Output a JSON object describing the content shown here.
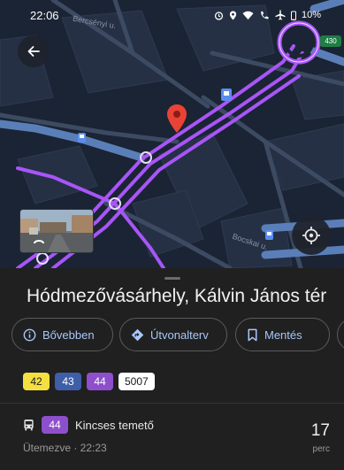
{
  "status_bar": {
    "time": "22:06",
    "battery": "10%",
    "icons": [
      "alarm-icon",
      "location-icon",
      "wifi-icon",
      "wifi-calling-icon",
      "airplane-icon",
      "battery-icon"
    ]
  },
  "map": {
    "streets": [
      "Bercsényi u.",
      "Bocskai u."
    ],
    "road_number": "430",
    "route_color": "#a855f7",
    "pin_color": "#ea4335"
  },
  "place": {
    "title": "Hódmezővásárhely, Kálvin János tér"
  },
  "actions": [
    {
      "label": "Bővebben",
      "icon": "info-icon"
    },
    {
      "label": "Útvonalterv",
      "icon": "directions-icon"
    },
    {
      "label": "Mentés",
      "icon": "bookmark-icon"
    },
    {
      "label": "",
      "icon": "share-icon"
    }
  ],
  "routes": [
    {
      "number": "42",
      "bg": "#f5e042",
      "fg": "#1a1a1a"
    },
    {
      "number": "43",
      "bg": "#3f5ea8",
      "fg": "#ffffff"
    },
    {
      "number": "44",
      "bg": "#8f4fcc",
      "fg": "#ffffff"
    },
    {
      "number": "5007",
      "bg": "#ffffff",
      "fg": "#1a1a1a"
    }
  ],
  "departure": {
    "route": "44",
    "route_bg": "#8f4fcc",
    "destination": "Kincses temető",
    "schedule": "Ütemezve · 22:23",
    "minutes": "17",
    "unit": "perc"
  }
}
